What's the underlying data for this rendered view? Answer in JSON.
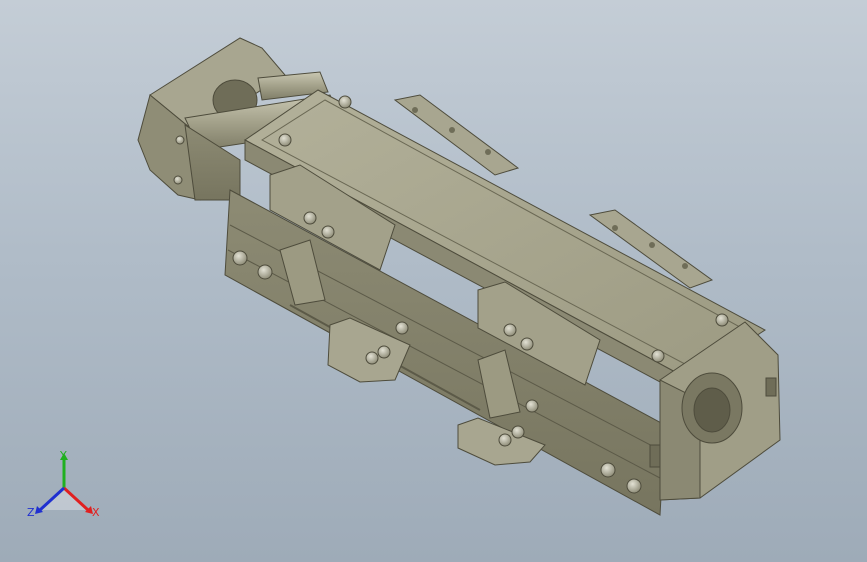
{
  "viewport": {
    "background_top": "#c4cdd6",
    "background_bottom": "#9eabb8",
    "model_color": "#9c9a82",
    "model_shadow": "#6f6d58"
  },
  "triad": {
    "x_label": "X",
    "y_label": "Y",
    "z_label": "Z",
    "x_color": "#e02020",
    "y_color": "#20b020",
    "z_color": "#2030d0"
  }
}
